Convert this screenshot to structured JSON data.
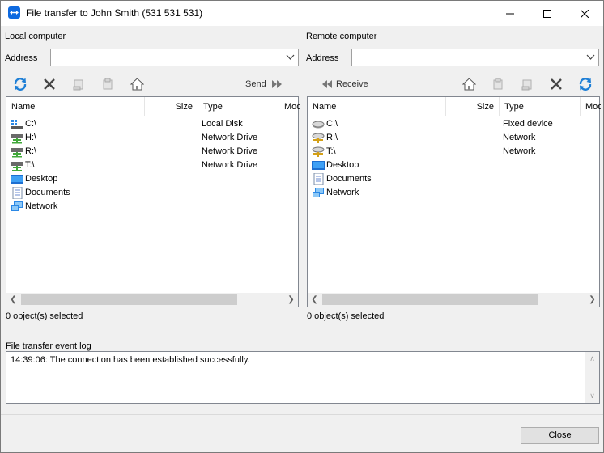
{
  "window": {
    "title": "File transfer to John Smith (531 531 531)"
  },
  "local": {
    "label": "Local computer",
    "address_label": "Address",
    "address_value": "",
    "send_label": "Send",
    "columns": [
      "Name",
      "Size",
      "Type",
      "Moc"
    ],
    "items": [
      {
        "name": "C:\\",
        "type": "Local Disk",
        "icon": "local-disk-icon"
      },
      {
        "name": "H:\\",
        "type": "Network Drive",
        "icon": "network-drive-icon"
      },
      {
        "name": "R:\\",
        "type": "Network Drive",
        "icon": "network-drive-icon"
      },
      {
        "name": "T:\\",
        "type": "Network Drive",
        "icon": "network-drive-icon"
      },
      {
        "name": "Desktop",
        "type": "",
        "icon": "desktop-icon"
      },
      {
        "name": "Documents",
        "type": "",
        "icon": "documents-icon"
      },
      {
        "name": "Network",
        "type": "",
        "icon": "network-icon"
      }
    ],
    "status": "0 object(s) selected",
    "scroll_position": 0.0
  },
  "remote": {
    "label": "Remote computer",
    "address_label": "Address",
    "address_value": "",
    "receive_label": "Receive",
    "columns": [
      "Name",
      "Size",
      "Type",
      "Moc"
    ],
    "items": [
      {
        "name": "C:\\",
        "type": "Fixed device",
        "icon": "fixed-drive-icon"
      },
      {
        "name": "R:\\",
        "type": "Network",
        "icon": "network-drive-icon"
      },
      {
        "name": "T:\\",
        "type": "Network",
        "icon": "network-drive-icon"
      },
      {
        "name": "Desktop",
        "type": "",
        "icon": "desktop-icon"
      },
      {
        "name": "Documents",
        "type": "",
        "icon": "documents-icon"
      },
      {
        "name": "Network",
        "type": "",
        "icon": "network-icon"
      }
    ],
    "status": "0 object(s) selected",
    "scroll_position": 0.0
  },
  "log": {
    "label": "File transfer event log",
    "entries": [
      "14:39:06: The connection has been established successfully."
    ]
  },
  "footer": {
    "close_label": "Close"
  },
  "colors": {
    "accent": "#0e6ae0",
    "window_bg": "#f0f0f0"
  }
}
